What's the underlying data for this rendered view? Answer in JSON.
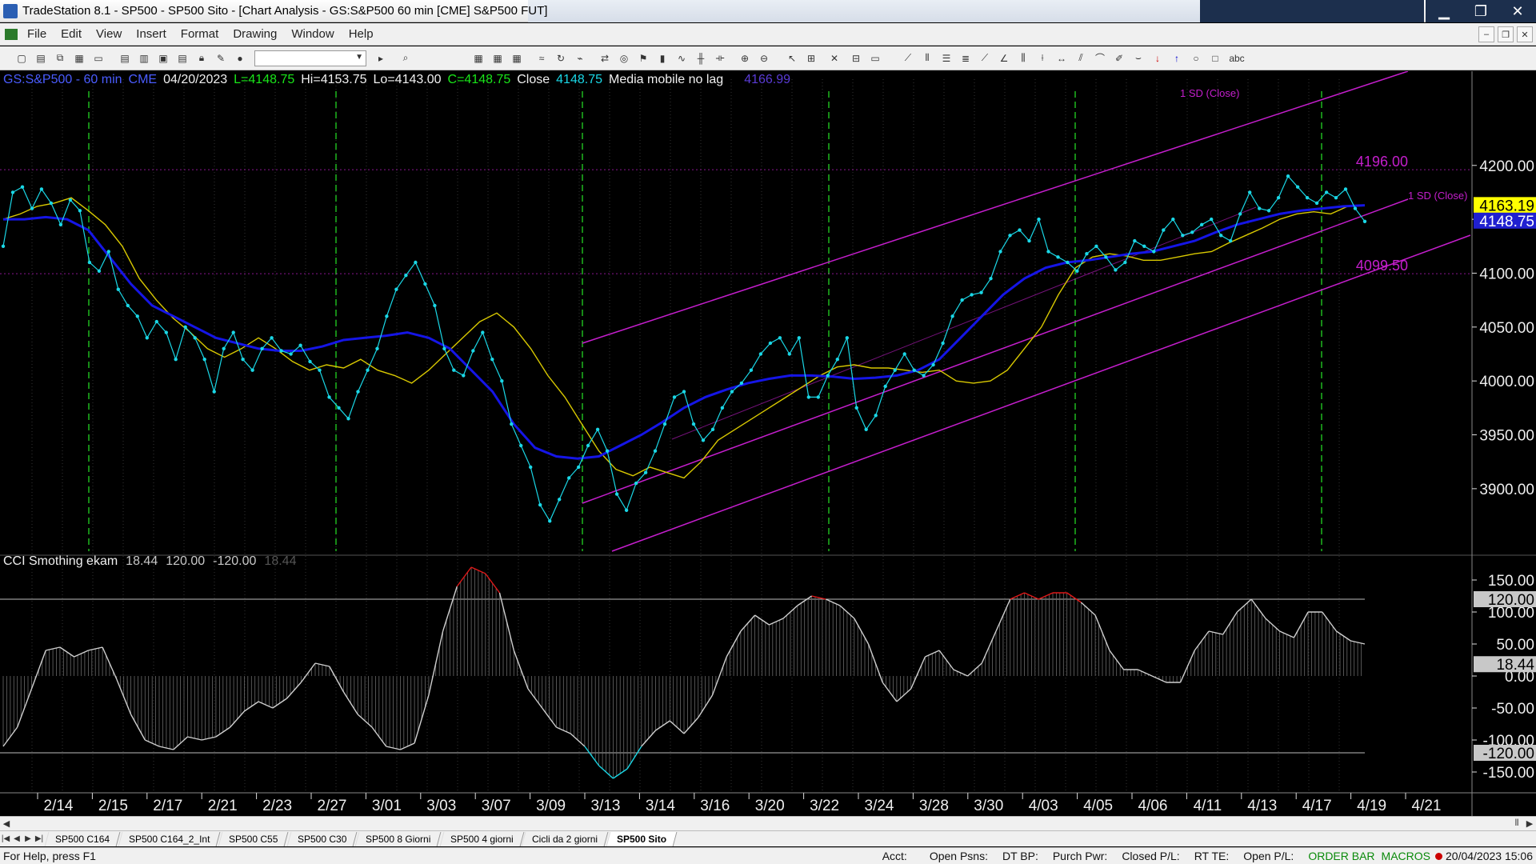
{
  "window": {
    "title": "TradeStation 8.1 - SP500 - SP500 Sito - [Chart Analysis - GS:S&P500  60 min  [CME] S&P500 FUT]",
    "controls": {
      "minimize": "▁",
      "maximize": "❐",
      "close": "✕"
    }
  },
  "menu": {
    "items": [
      "File",
      "Edit",
      "View",
      "Insert",
      "Format",
      "Drawing",
      "Window",
      "Help"
    ]
  },
  "header": {
    "symbol": "GS:S&P500 - 60 min",
    "exchange": "CME",
    "date": "04/20/2023",
    "last": "L=4148.75",
    "hi": "Hi=4153.75",
    "lo": "Lo=4143.00",
    "close_val": "C=4148.75",
    "close_label": "Close",
    "close_value": "4148.75",
    "ma_label": "Media mobile no lag",
    "ma_value": "4166.99"
  },
  "cci_header": {
    "label": "CCI Smothing ekam",
    "v1": "18.44",
    "v2": "120.00",
    "v3": "-120.00",
    "v4": "18.44"
  },
  "colors": {
    "price": "#1ad7e6",
    "ma_blue": "#1515e6",
    "ma_yellow": "#d8c800",
    "channel": "#c41ecc",
    "cycle_lines": "#1fb81f",
    "cci_line": "#cfcfcf",
    "cci_high": "#e01818",
    "cci_low": "#1ad7e6"
  },
  "price_axis": {
    "ticks": [
      "4200.00",
      "4150.00",
      "4100.00",
      "4050.00",
      "4000.00",
      "3950.00",
      "3900.00"
    ],
    "values": [
      4200,
      4150,
      4100,
      4050,
      4000,
      3950,
      3900
    ],
    "badges": {
      "ma": "4163.19",
      "last": "4148.75"
    },
    "levels": [
      {
        "label": "4196.00",
        "value": 4196
      },
      {
        "label": "4099.50",
        "value": 4099.5
      }
    ],
    "channel_labels": [
      "1 SD (Close)",
      "1 SD (Close)"
    ],
    "range": [
      3842,
      4280
    ]
  },
  "cci_axis": {
    "ticks": [
      "150.00",
      "100.00",
      "50.00",
      "0.00",
      "-50.00",
      "-100.00",
      "-150.00"
    ],
    "values": [
      150,
      100,
      50,
      0,
      -50,
      -100,
      -150
    ],
    "badges": {
      "upper": "120.00",
      "current": "18.44",
      "lower": "-120.00"
    },
    "range": [
      -180,
      180
    ]
  },
  "time_axis": {
    "labels": [
      "2/14",
      "2/15",
      "2/17",
      "2/21",
      "2/23",
      "2/27",
      "3/01",
      "3/03",
      "3/07",
      "3/09",
      "3/13",
      "3/14",
      "3/16",
      "3/20",
      "3/22",
      "3/24",
      "3/28",
      "3/30",
      "4/03",
      "4/05",
      "4/06",
      "4/11",
      "4/13",
      "4/17",
      "4/19",
      "4/21"
    ]
  },
  "chart_data": {
    "type": "line",
    "title": "GS:S&P500 - 60 min",
    "xlabel": "",
    "ylabel": "",
    "ylim": [
      3842,
      4280
    ],
    "series": [
      {
        "name": "Close",
        "values": [
          4125,
          4175,
          4180,
          4160,
          4178,
          4165,
          4145,
          4168,
          4158,
          4110,
          4102,
          4120,
          4085,
          4070,
          4060,
          4040,
          4055,
          4045,
          4020,
          4050,
          4040,
          4020,
          3990,
          4030,
          4045,
          4020,
          4010,
          4030,
          4040,
          4028,
          4025,
          4033,
          4018,
          4010,
          3985,
          3975,
          3965,
          3990,
          4010,
          4030,
          4060,
          4085,
          4098,
          4110,
          4090,
          4070,
          4030,
          4010,
          4005,
          4028,
          4045,
          4020,
          4000,
          3960,
          3940,
          3920,
          3885,
          3870,
          3890,
          3910,
          3920,
          3940,
          3955,
          3935,
          3895,
          3880,
          3905,
          3915,
          3935,
          3960,
          3985,
          3990,
          3960,
          3945,
          3955,
          3975,
          3990,
          3998,
          4010,
          4025,
          4035,
          4040,
          4025,
          4040,
          3985,
          3985,
          4005,
          4020,
          4040,
          3975,
          3955,
          3968,
          3995,
          4010,
          4025,
          4010,
          4005,
          4015,
          4035,
          4060,
          4075,
          4080,
          4082,
          4095,
          4120,
          4135,
          4140,
          4130,
          4150,
          4120,
          4115,
          4110,
          4102,
          4118,
          4125,
          4115,
          4103,
          4110,
          4130,
          4125,
          4120,
          4140,
          4150,
          4135,
          4138,
          4145,
          4150,
          4135,
          4130,
          4155,
          4175,
          4160,
          4158,
          4170,
          4190,
          4180,
          4170,
          4165,
          4175,
          4170,
          4178,
          4160,
          4148
        ]
      },
      {
        "name": "Media mobile no lag",
        "values": [
          4150,
          4155,
          4162,
          4165,
          4170,
          4158,
          4145,
          4125,
          4095,
          4075,
          4058,
          4045,
          4030,
          4022,
          4030,
          4040,
          4030,
          4018,
          4010,
          4015,
          4012,
          4020,
          4010,
          4005,
          3998,
          4010,
          4025,
          4040,
          4055,
          4063,
          4050,
          4030,
          4005,
          3985,
          3960,
          3935,
          3918,
          3912,
          3920,
          3915,
          3910,
          3925,
          3945,
          3955,
          3965,
          3975,
          3985,
          3995,
          4005,
          4013,
          4015,
          4012,
          4012,
          4010,
          4008,
          4010,
          4000,
          3998,
          4000,
          4010,
          4030,
          4050,
          4080,
          4105,
          4115,
          4118,
          4116,
          4112,
          4112,
          4115,
          4118,
          4120,
          4128,
          4135,
          4142,
          4150,
          4155,
          4157,
          4155,
          4162,
          4163
        ]
      },
      {
        "name": "4166.99",
        "values": [
          4150,
          4150,
          4152,
          4150,
          4140,
          4115,
          4090,
          4070,
          4060,
          4050,
          4040,
          4035,
          4030,
          4028,
          4028,
          4032,
          4038,
          4040,
          4042,
          4045,
          4040,
          4030,
          4010,
          3990,
          3960,
          3938,
          3930,
          3928,
          3930,
          3940,
          3950,
          3962,
          3975,
          3985,
          3992,
          3998,
          4002,
          4005,
          4005,
          4004,
          4002,
          4003,
          4005,
          4010,
          4020,
          4040,
          4060,
          4080,
          4095,
          4105,
          4110,
          4112,
          4115,
          4118,
          4120,
          4125,
          4130,
          4138,
          4145,
          4150,
          4155,
          4158,
          4160,
          4162,
          4163
        ]
      },
      {
        "name": "CCI Smothing ekam",
        "values": [
          -110,
          -80,
          -20,
          40,
          45,
          30,
          40,
          45,
          -5,
          -60,
          -100,
          -110,
          -115,
          -95,
          -100,
          -95,
          -80,
          -55,
          -40,
          -50,
          -35,
          -10,
          20,
          15,
          -25,
          -60,
          -80,
          -110,
          -115,
          -105,
          -30,
          70,
          140,
          170,
          160,
          130,
          40,
          -20,
          -50,
          -80,
          -90,
          -110,
          -140,
          -160,
          -145,
          -110,
          -85,
          -70,
          -90,
          -65,
          -30,
          30,
          70,
          95,
          80,
          90,
          110,
          125,
          120,
          110,
          90,
          50,
          -10,
          -40,
          -20,
          30,
          40,
          10,
          0,
          20,
          70,
          120,
          130,
          120,
          130,
          130,
          115,
          95,
          40,
          10,
          10,
          0,
          -10,
          -10,
          40,
          70,
          65,
          100,
          120,
          90,
          70,
          60,
          100,
          100,
          70,
          55,
          50
        ]
      }
    ]
  },
  "tabs": {
    "items": [
      "SP500 C164",
      "SP500 C164_2_Int",
      "SP500 C55",
      "SP500 C30",
      "SP500 8 Giorni",
      "SP500 4 giorni",
      "Cicli da 2 giorni",
      "SP500 Sito"
    ],
    "active": "SP500 Sito"
  },
  "status": {
    "help": "For Help, press F1",
    "acct": "Acct:",
    "open_psns": "Open Psns:",
    "dt_bp": "DT BP:",
    "purch_pwr": "Purch Pwr:",
    "closed_pl": "Closed P/L:",
    "rt_te": "RT TE:",
    "open_pl": "Open P/L:",
    "order_bar": "ORDER BAR",
    "macros": "MACROS",
    "datetime": "20/04/2023 15:06"
  }
}
